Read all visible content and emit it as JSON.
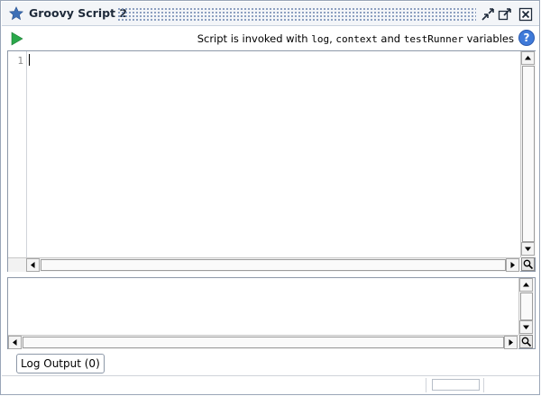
{
  "window": {
    "title": "Groovy Script 2"
  },
  "toolbar": {
    "hint_prefix": "Script is invoked with",
    "hint_var1": "log",
    "hint_sep1": ",",
    "hint_var2": "context",
    "hint_and": "and",
    "hint_var3": "testRunner",
    "hint_suffix": "variables",
    "help_label": "?"
  },
  "editor": {
    "line_numbers": [
      "1"
    ],
    "content": ""
  },
  "output": {
    "content": ""
  },
  "tabs": {
    "log_output": "Log Output (0)"
  },
  "icons": {
    "title": "star-icon",
    "run": "play-icon",
    "help": "help-icon",
    "undock": "undock-icon",
    "maximize": "maximize-icon",
    "close": "close-icon"
  },
  "colors": {
    "accent": "#3f7ad9",
    "run_green": "#2aa84a",
    "star_blue": "#3d6fb6"
  }
}
